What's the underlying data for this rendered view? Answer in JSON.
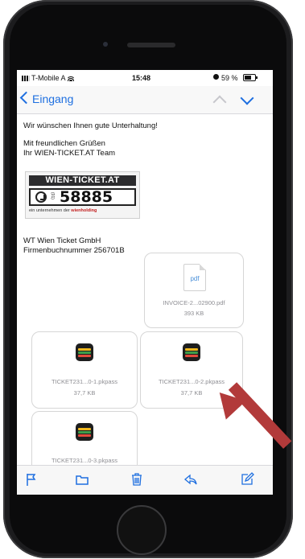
{
  "status": {
    "carrier": "T-Mobile A",
    "time": "15:48",
    "battery": "59 %"
  },
  "nav": {
    "back_label": "Eingang"
  },
  "email": {
    "line1": "Wir wünschen Ihnen gute Unterhaltung!",
    "line2": "Mit freundlichen Grüßen",
    "line3": "Ihr WIEN-TICKET.AT Team",
    "logo": {
      "brand": "WIEN-TICKET.AT",
      "number": "58885",
      "prefix": "(01)",
      "footer_prefix": "ein unternehmen der",
      "footer_brand": "wienholding"
    },
    "company": "WT Wien Ticket GmbH",
    "register": "Firmenbuchnummer 256701B"
  },
  "attachments": [
    {
      "type": "pdf",
      "icon_label": "pdf",
      "name": "INVOICE-2...02900.pdf",
      "size": "393 KB"
    },
    {
      "type": "pkpass",
      "name": "TICKET231...0-1.pkpass",
      "size": "37,7 KB"
    },
    {
      "type": "pkpass",
      "name": "TICKET231...0-2.pkpass",
      "size": "37,7 KB"
    },
    {
      "type": "pkpass",
      "name": "TICKET231...0-3.pkpass",
      "size": ""
    }
  ],
  "colors": {
    "accent": "#1e6fe0",
    "arrow": "#b23a3a"
  }
}
